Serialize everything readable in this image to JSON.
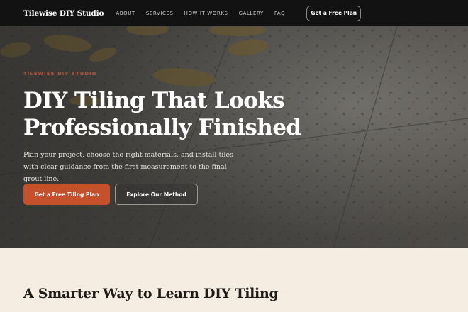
{
  "nav": {
    "brand": "Tilewise DIY Studio",
    "links": [
      "ABOUT",
      "SERVICES",
      "HOW IT WORKS",
      "GALLERY",
      "FAQ"
    ],
    "cta": "Get a Free Plan"
  },
  "hero": {
    "eyebrow": "TILEWISE DIY STUDIO",
    "title": "DIY Tiling That Looks Professionally Finished",
    "lead": "Plan your project, choose the right materials, and install tiles with clear guidance from the first measurement to the final grout line.",
    "primary_button": "Get a Free Tiling Plan",
    "secondary_button": "Explore Our Method"
  },
  "section": {
    "title": "A Smarter Way to Learn DIY Tiling"
  },
  "colors": {
    "accent": "#c4512c",
    "nav_bg": "#121212",
    "section_bg": "#f5ede1"
  }
}
